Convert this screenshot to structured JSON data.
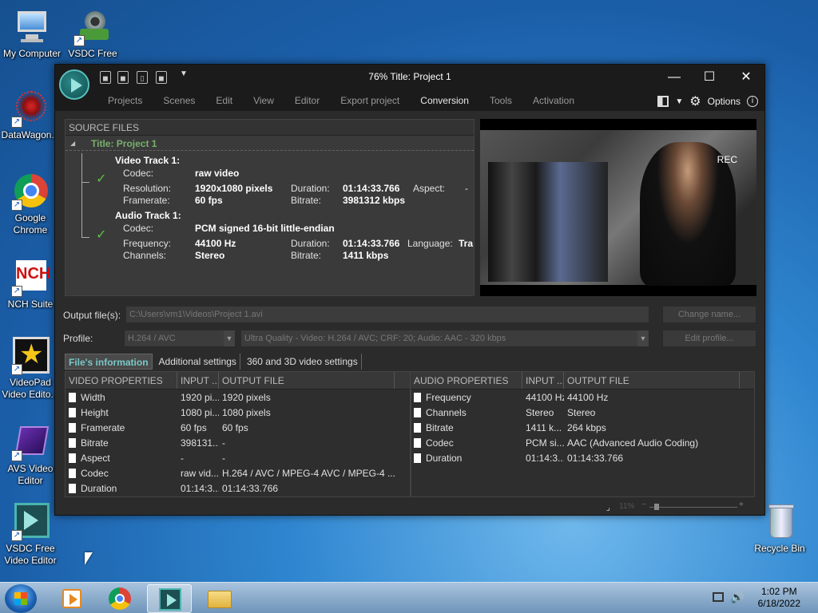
{
  "desktop": {
    "icons": [
      {
        "label": "My Computer"
      },
      {
        "label": "VSDC Free Video C..."
      },
      {
        "label": "DataWagon..."
      },
      {
        "label": "Google Chrome"
      },
      {
        "label": "NCH Suite"
      },
      {
        "label": "VideoPad Video Edito..."
      },
      {
        "label": "AVS Video Editor"
      },
      {
        "label": "VSDC Free Video Editor"
      },
      {
        "label": "Recycle Bin"
      }
    ]
  },
  "window": {
    "title": "76% Title: Project 1",
    "menu": [
      "Projects",
      "Scenes",
      "Edit",
      "View",
      "Editor",
      "Export project",
      "Conversion",
      "Tools",
      "Activation"
    ],
    "active_menu": "Conversion",
    "options_label": "Options",
    "minimize": "—",
    "maximize": "☐",
    "close": "✕"
  },
  "source": {
    "header": "SOURCE FILES",
    "project_title": "Title: Project 1",
    "video_track": {
      "label": "Video Track 1:",
      "codec_label": "Codec:",
      "codec": "raw video",
      "resolution_label": "Resolution:",
      "resolution": "1920x1080 pixels",
      "duration_label": "Duration:",
      "duration": "01:14:33.766",
      "aspect_label": "Aspect:",
      "aspect": "-",
      "framerate_label": "Framerate:",
      "framerate": "60 fps",
      "bitrate_label": "Bitrate:",
      "bitrate": "3981312 kbps"
    },
    "audio_track": {
      "label": "Audio Track 1:",
      "codec_label": "Codec:",
      "codec": "PCM signed 16-bit little-endian",
      "frequency_label": "Frequency:",
      "frequency": "44100 Hz",
      "duration_label": "Duration:",
      "duration": "01:14:33.766",
      "language_label": "Language:",
      "language": "Tra",
      "channels_label": "Channels:",
      "channels": "Stereo",
      "bitrate_label": "Bitrate:",
      "bitrate": "1411 kbps"
    }
  },
  "preview": {
    "rec_text": "REC"
  },
  "output": {
    "label": "Output file(s):",
    "value": "C:\\Users\\vm1\\Videos\\Project 1.avi",
    "change_name": "Change name..."
  },
  "profile": {
    "label": "Profile:",
    "codec": "H.264 / AVC",
    "preset": "Ultra Quality - Video: H.264 / AVC; CRF: 20; Audio: AAC - 320 kbps",
    "edit_profile": "Edit profile..."
  },
  "tabs": [
    "File's information",
    "Additional settings",
    "360 and 3D video settings"
  ],
  "video_table": {
    "headers": [
      "VIDEO PROPERTIES",
      "INPUT ...",
      "OUTPUT FILE"
    ],
    "rows": [
      [
        "Width",
        "1920 pi...",
        "1920 pixels"
      ],
      [
        "Height",
        "1080 pi...",
        "1080 pixels"
      ],
      [
        "Framerate",
        "60 fps",
        "60 fps"
      ],
      [
        "Bitrate",
        "398131...",
        "-"
      ],
      [
        "Aspect",
        "-",
        "-"
      ],
      [
        "Codec",
        "raw vid...",
        "H.264 / AVC / MPEG-4 AVC / MPEG-4 ..."
      ],
      [
        "Duration",
        "01:14:3...",
        "01:14:33.766"
      ]
    ]
  },
  "audio_table": {
    "headers": [
      "AUDIO PROPERTIES",
      "INPUT ...",
      "OUTPUT FILE"
    ],
    "rows": [
      [
        "Frequency",
        "44100 Hz",
        "44100 Hz"
      ],
      [
        "Channels",
        "Stereo",
        "Stereo"
      ],
      [
        "Bitrate",
        "1411 k...",
        "264 kbps"
      ],
      [
        "Codec",
        "PCM si...",
        "AAC (Advanced Audio Coding)"
      ],
      [
        "Duration",
        "01:14:3...",
        "01:14:33.766"
      ]
    ]
  },
  "status": {
    "zoom": "11%"
  },
  "taskbar": {
    "time": "1:02 PM",
    "date": "6/18/2022"
  }
}
